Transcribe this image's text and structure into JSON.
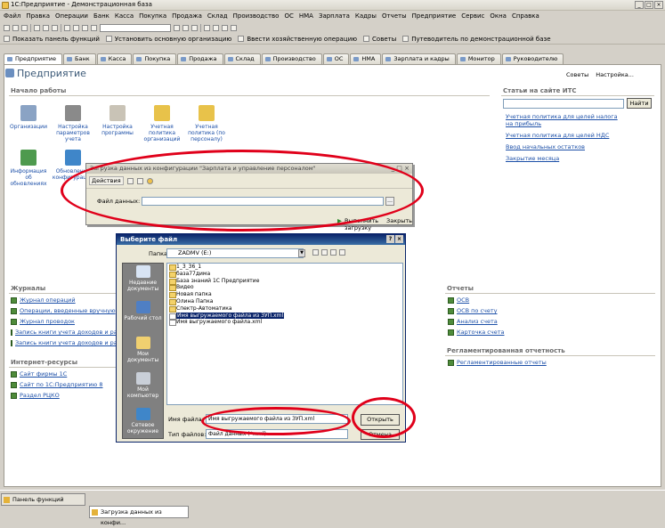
{
  "window": {
    "title": "1С:Предприятие - Демонстрационная база"
  },
  "menu": [
    "Файл",
    "Правка",
    "Операции",
    "Банк",
    "Касса",
    "Покупка",
    "Продажа",
    "Склад",
    "Производство",
    "ОС",
    "НМА",
    "Зарплата",
    "Кадры",
    "Отчеты",
    "Предприятие",
    "Сервис",
    "Окна",
    "Справка"
  ],
  "toolbar2": {
    "show_panel": "Показать панель функций",
    "set_org": "Установить основную организацию",
    "enter_op": "Ввести хозяйственную операцию",
    "tips": "Советы",
    "guide": "Путеводитель по демонстрационной базе"
  },
  "tabs": [
    "Предприятие",
    "Банк",
    "Касса",
    "Покупка",
    "Продажа",
    "Склад",
    "Производство",
    "ОС",
    "НМА",
    "Зарплата и кадры",
    "Монитор",
    "Руководителю"
  ],
  "panel": {
    "title": "Предприятие",
    "tips": "Советы",
    "settings": "Настройка...",
    "start_title": "Начало работы",
    "start_icons": [
      {
        "label": "Организации",
        "color": "#8aa3c4"
      },
      {
        "label": "Настройка параметров учета",
        "color": "#8a8a8a"
      },
      {
        "label": "Настройка программы",
        "color": "#c9c3b6"
      },
      {
        "label": "Учетная политика организаций",
        "color": "#e8c24a"
      },
      {
        "label": "Учетная политика (по персоналу)",
        "color": "#e8c24a"
      }
    ],
    "row2_icons": [
      {
        "label": "Информация об обновлениях",
        "color": "#4e9a4e"
      },
      {
        "label": "Обновление конфигурации",
        "color": "#3f86c9"
      }
    ],
    "its_title": "Статьи на сайте ИТС",
    "find_btn": "Найти",
    "its_links": [
      "Учетная политика для целей налога на прибыль",
      "Учетная политика для целей НДС",
      "Ввод начальных остатков",
      "Закрытие месяца"
    ],
    "journals_title": "Журналы",
    "journals": [
      "Журнал операций",
      "Операции, введенные вручную",
      "Журнал проводок",
      "Запись книги учета доходов и расх",
      "Запись книги учета доходов и расх"
    ],
    "internet_title": "Интернет-ресурсы",
    "internet": [
      "Сайт фирмы 1С",
      "Сайт по 1С:Предприятию 8",
      "Раздел РЦКО"
    ],
    "reports_title": "Отчеты",
    "reports": [
      "ОСВ",
      "ОСВ по счету",
      "Анализ счета",
      "Карточка счета"
    ],
    "reg_title": "Регламентированная отчетность",
    "reg": [
      "Регламентированные отчеты"
    ]
  },
  "load_dialog": {
    "title": "Загрузка данных из конфигурации \"Зарплата и управление персоналом\"",
    "actions": "Действия",
    "file_label": "Файл данных:",
    "file_value": "",
    "run": "Выполнить загрузку",
    "close": "Закрыть"
  },
  "file_dialog": {
    "title": "Выберите файл",
    "folder_label": "Папка:",
    "folder": "ZADMV (E:)",
    "places": [
      {
        "label": "Недавние документы",
        "color": "#d8e4f4"
      },
      {
        "label": "Рабочий стол",
        "color": "#4f7fc4"
      },
      {
        "label": "Мои документы",
        "color": "#f0d070"
      },
      {
        "label": "Мой компьютер",
        "color": "#c9cfd8"
      },
      {
        "label": "Сетевое окружение",
        "color": "#3f86c9"
      }
    ],
    "files": [
      "1_3_36_1",
      "база77дима",
      "База знаний 1С Предприятие",
      "Видео",
      "Новая папка",
      "Олина Папка",
      "Спектр-Автоматика",
      "Имя выгружаемого файла из ЗУП.xml",
      "Имя выгружаемого файла.xml"
    ],
    "selected": "Имя выгружаемого файла из ЗУП.xml",
    "name_label": "Имя файла:",
    "name_value": "Имя выгружаемого файла из ЗУП.xml",
    "type_label": "Тип файлов:",
    "type_value": "Файл данных (*.xml)",
    "open_btn": "Открыть",
    "cancel_btn": "Отмена"
  },
  "taskbar": [
    "Панель функций",
    "Загрузка данных из конфи..."
  ],
  "colors": {
    "highlight": "#e0001a",
    "link": "#1d50a8"
  }
}
